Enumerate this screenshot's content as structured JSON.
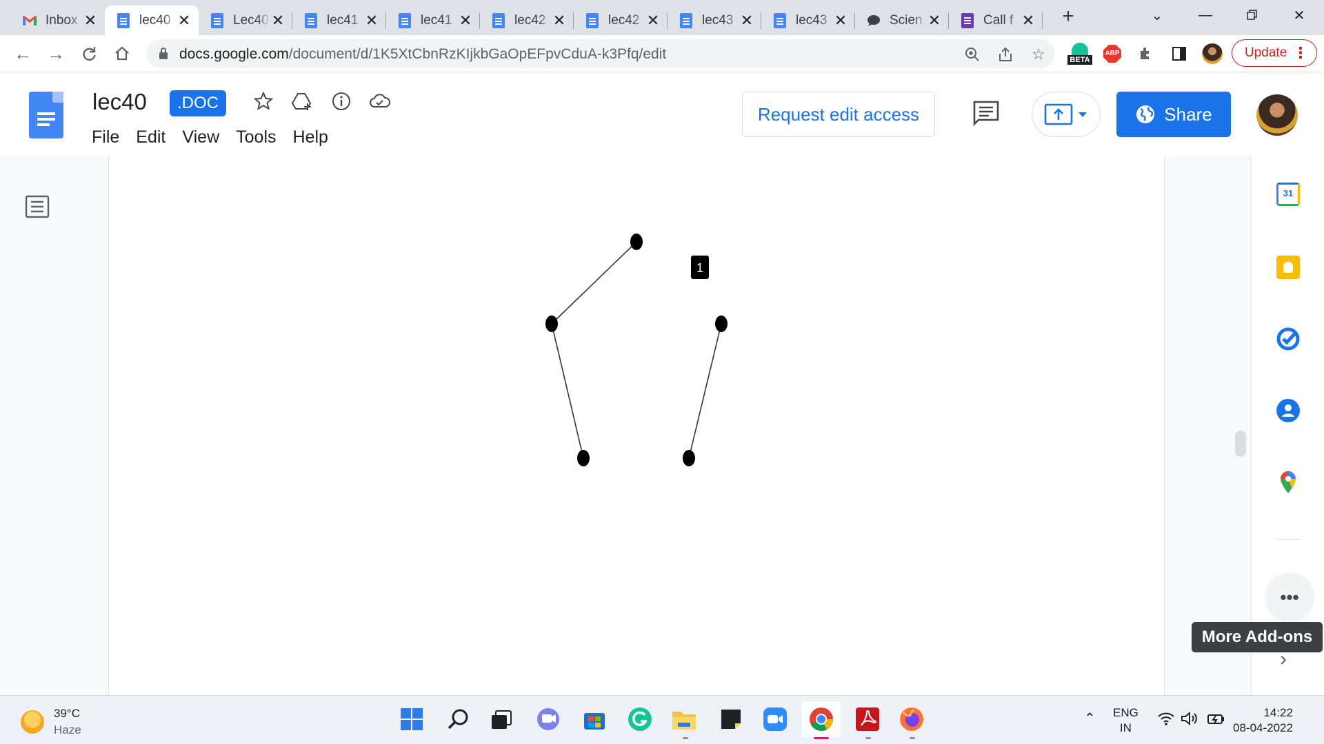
{
  "browser": {
    "tabs": [
      {
        "title": "Inbox",
        "icon": "gmail-icon"
      },
      {
        "title": "lec40",
        "icon": "docs-icon",
        "active": true
      },
      {
        "title": "Lec40",
        "icon": "docs-icon"
      },
      {
        "title": "lec41",
        "icon": "docs-icon"
      },
      {
        "title": "lec41",
        "icon": "docs-icon"
      },
      {
        "title": "lec42",
        "icon": "docs-icon"
      },
      {
        "title": "lec42",
        "icon": "docs-icon"
      },
      {
        "title": "lec43",
        "icon": "docs-icon"
      },
      {
        "title": "lec43",
        "icon": "docs-icon"
      },
      {
        "title": "Scien",
        "icon": "chat-icon"
      },
      {
        "title": "Call f",
        "icon": "forms-icon"
      }
    ],
    "url_host": "docs.google.com",
    "url_path": "/document/d/1K5XtCbnRzKIjkbGaOpEFpvCduA-k3Pfq/edit",
    "ext_beta_label": "BETA",
    "ext_abp_label": "ABP",
    "update_label": "Update"
  },
  "docs": {
    "title": "lec40",
    "badge": ".DOC",
    "menu": [
      "File",
      "Edit",
      "View",
      "Tools",
      "Help"
    ],
    "request_edit_label": "Request edit access",
    "share_label": "Share"
  },
  "document": {
    "label_box": "1"
  },
  "sidepanel": {
    "calendar_day": "31",
    "tooltip": "More Add-ons"
  },
  "taskbar": {
    "temperature": "39°C",
    "weather": "Haze",
    "lang_top": "ENG",
    "lang_bottom": "IN",
    "time": "14:22",
    "date": "08-04-2022"
  },
  "colors": {
    "accent": "#1a73e8",
    "docs_blue": "#4285f4",
    "update_red": "#c5221f"
  }
}
